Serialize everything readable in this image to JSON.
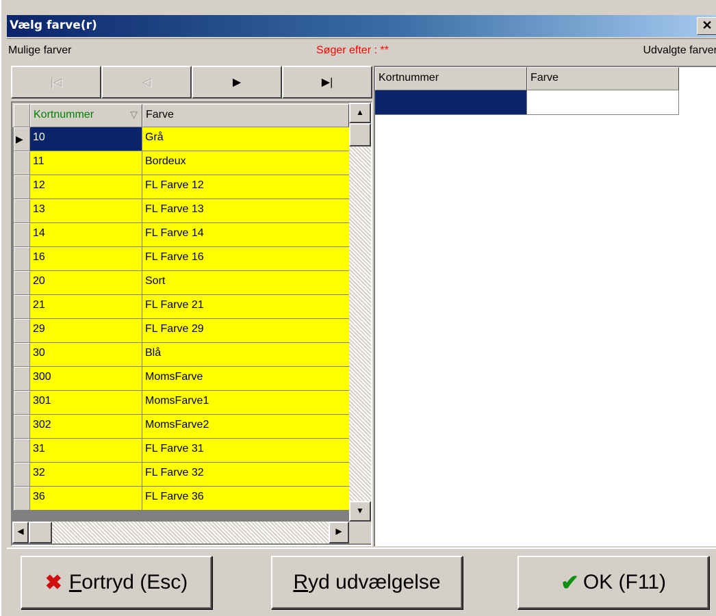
{
  "window": {
    "title": "Vælg farve(r)",
    "close_label": "✕"
  },
  "header": {
    "left_label": "Mulige farver",
    "search_status": "Søger efter : **",
    "right_label": "Udvalgte farver"
  },
  "navigator": {
    "first": "|◁",
    "prior": "◁",
    "next": "▶",
    "last": "▶|"
  },
  "left_grid": {
    "columns": [
      "Kortnummer",
      "Farve"
    ],
    "sort_glyph": "▽",
    "selected_index": 0,
    "current_marker": "▶",
    "rows": [
      {
        "kortnummer": "10",
        "farve": "Grå"
      },
      {
        "kortnummer": "11",
        "farve": "Bordeux"
      },
      {
        "kortnummer": "12",
        "farve": "FL Farve 12"
      },
      {
        "kortnummer": "13",
        "farve": "FL Farve 13"
      },
      {
        "kortnummer": "14",
        "farve": "FL Farve 14"
      },
      {
        "kortnummer": "16",
        "farve": "FL Farve 16"
      },
      {
        "kortnummer": "20",
        "farve": "Sort"
      },
      {
        "kortnummer": "21",
        "farve": "FL Farve 21"
      },
      {
        "kortnummer": "29",
        "farve": "FL Farve 29"
      },
      {
        "kortnummer": "30",
        "farve": "Blå"
      },
      {
        "kortnummer": "300",
        "farve": "MomsFarve"
      },
      {
        "kortnummer": "301",
        "farve": "MomsFarve1"
      },
      {
        "kortnummer": "302",
        "farve": "MomsFarve2"
      },
      {
        "kortnummer": "31",
        "farve": "FL Farve 31"
      },
      {
        "kortnummer": "32",
        "farve": "FL Farve 32"
      },
      {
        "kortnummer": "36",
        "farve": "FL Farve 36"
      }
    ],
    "row_color": "#ffff00",
    "header_sort_color": "#008000"
  },
  "right_grid": {
    "columns": [
      "Kortnummer",
      "Farve"
    ]
  },
  "buttons": {
    "cancel": {
      "accel": "F",
      "rest": "ortryd (Esc)",
      "icon": "x-icon"
    },
    "clear": {
      "accel": "R",
      "rest": "yd udvælgelse"
    },
    "ok": {
      "label": "OK (F11)",
      "icon": "checkmark-icon"
    }
  }
}
